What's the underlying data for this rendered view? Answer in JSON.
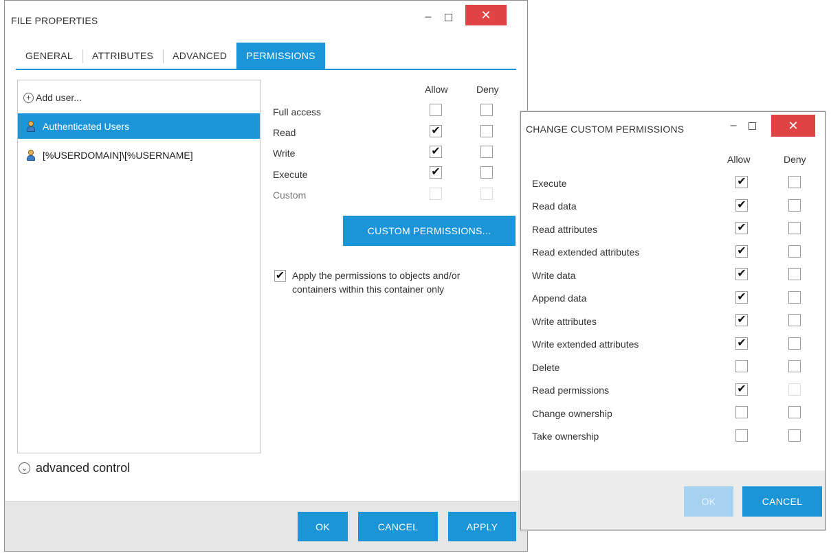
{
  "main": {
    "title": "FILE PROPERTIES",
    "window_controls": {
      "minimize": "–",
      "close": "✕"
    },
    "tabs": [
      {
        "label": "GENERAL",
        "active": false
      },
      {
        "label": "ATTRIBUTES",
        "active": false
      },
      {
        "label": "ADVANCED",
        "active": false
      },
      {
        "label": "PERMISSIONS",
        "active": true
      }
    ],
    "add_user_label": "Add user...",
    "users": [
      {
        "label": "Authenticated Users",
        "selected": true
      },
      {
        "label": "[%USERDOMAIN]\\[%USERNAME]",
        "selected": false
      }
    ],
    "columns": {
      "allow": "Allow",
      "deny": "Deny"
    },
    "permissions": [
      {
        "label": "Full access",
        "allow": false,
        "deny": false,
        "enabled": true
      },
      {
        "label": "Read",
        "allow": true,
        "deny": false,
        "enabled": true
      },
      {
        "label": "Write",
        "allow": true,
        "deny": false,
        "enabled": true
      },
      {
        "label": "Execute",
        "allow": true,
        "deny": false,
        "enabled": true
      },
      {
        "label": "Custom",
        "allow": false,
        "deny": false,
        "enabled": false
      }
    ],
    "custom_permissions_button": "CUSTOM PERMISSIONS...",
    "apply_checkbox_label": "Apply the permissions to objects and/or containers within this container only",
    "apply_checked": true,
    "advanced_control_label": "advanced control",
    "footer": {
      "ok": "OK",
      "cancel": "CANCEL",
      "apply": "APPLY"
    }
  },
  "dialog": {
    "title": "CHANGE CUSTOM PERMISSIONS",
    "window_controls": {
      "minimize": "–",
      "close": "✕"
    },
    "columns": {
      "allow": "Allow",
      "deny": "Deny"
    },
    "permissions": [
      {
        "label": "Execute",
        "allow": true,
        "deny": false
      },
      {
        "label": "Read data",
        "allow": true,
        "deny": false
      },
      {
        "label": "Read attributes",
        "allow": true,
        "deny": false
      },
      {
        "label": "Read extended attributes",
        "allow": true,
        "deny": false
      },
      {
        "label": "Write data",
        "allow": true,
        "deny": false
      },
      {
        "label": "Append data",
        "allow": true,
        "deny": false
      },
      {
        "label": "Write attributes",
        "allow": true,
        "deny": false
      },
      {
        "label": "Write extended attributes",
        "allow": true,
        "deny": false
      },
      {
        "label": "Delete",
        "allow": false,
        "deny": false
      },
      {
        "label": "Read permissions",
        "allow": true,
        "deny": false
      },
      {
        "label": "Change ownership",
        "allow": false,
        "deny": false
      },
      {
        "label": "Take ownership",
        "allow": false,
        "deny": false
      }
    ],
    "footer": {
      "ok": "OK",
      "cancel": "CANCEL",
      "ok_enabled": false
    }
  },
  "colors": {
    "accent": "#1b95d8",
    "close": "#e04343"
  },
  "icons": {
    "add": "plus-circle-icon",
    "user": "user-icon",
    "expand": "chevron-down-circle-icon",
    "check": "✔"
  }
}
